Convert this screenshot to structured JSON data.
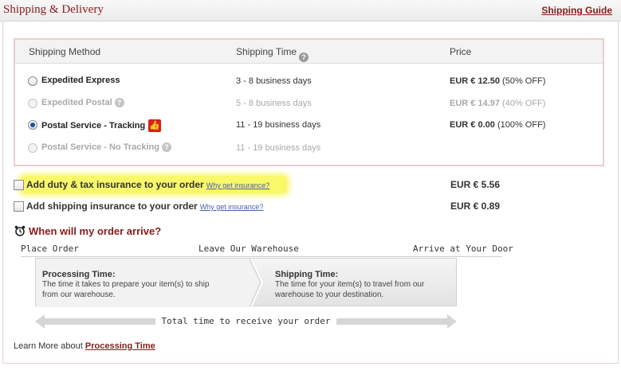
{
  "header": {
    "title": "Shipping & Delivery",
    "guide_link": "Shipping Guide"
  },
  "table": {
    "col_method": "Shipping Method",
    "col_time": "Shipping Time",
    "col_price": "Price",
    "methods": [
      {
        "name": "Expedited Express",
        "time": "3 - 8 business days",
        "price_main": "EUR € 12.50",
        "price_note": "(50% OFF)",
        "state": "available"
      },
      {
        "name": "Expedited Postal",
        "time": "5 - 8 business days",
        "price_main": "EUR € 14.97",
        "price_note": "(40% OFF)",
        "state": "disabled"
      },
      {
        "name": "Postal Service - Tracking",
        "time": "11 - 19 business days",
        "price_main": "EUR € 0.00",
        "price_note": "(100% OFF)",
        "state": "selected"
      },
      {
        "name": "Postal Service - No Tracking",
        "time": "11 - 19 business days",
        "price_main": "",
        "price_note": "",
        "state": "disabled"
      }
    ]
  },
  "options": [
    {
      "label": "Add duty & tax insurance to your order",
      "why": "Why get insurance?",
      "price": "EUR € 5.56",
      "checked": false,
      "highlighted": true
    },
    {
      "label": "Add shipping insurance to your order",
      "why": "Why get insurance?",
      "price": "EUR € 0.89",
      "checked": false,
      "highlighted": false
    }
  ],
  "arrival": {
    "heading": "When will my order arrive?",
    "timeline_labels": [
      "Place Order",
      "Leave Our Warehouse",
      "Arrive at Your Door"
    ],
    "processing_title": "Processing Time:",
    "processing_desc_1": "The time it takes to prepare your item(s) to ship",
    "processing_desc_2": "from our warehouse.",
    "shipping_title": "Shipping Time:",
    "shipping_desc_1": "The time  for your item(s) to travel from our",
    "shipping_desc_2": "warehouse to your destination.",
    "total_label": "Total time to receive your order"
  },
  "footer": {
    "learn_prefix": "Learn More about",
    "learn_link": "Processing Time"
  },
  "icons": {
    "question": "question-circle-icon",
    "thumb": "thumbs-up-icon",
    "clock": "alarm-clock-icon"
  },
  "colors": {
    "accent": "#8b1a1a",
    "highlight": "#f8f86a",
    "link": "#4a5ea8",
    "thumb": "#d92020"
  }
}
